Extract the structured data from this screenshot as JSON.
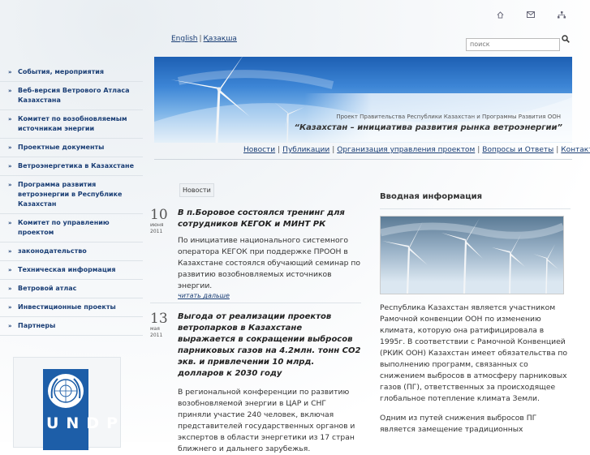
{
  "header": {
    "icons": [
      "home-icon",
      "mail-icon",
      "sitemap-icon"
    ],
    "lang_english": "English",
    "lang_kazakh": "Қазақша",
    "lang_sep": "|",
    "search_placeholder": "поиск"
  },
  "banner": {
    "subtitle": "Проект Правительства Республики Казахстан и Программы Развития ООН",
    "headline": "“Казахстан – инициатива развития рынка ветроэнергии”"
  },
  "topnav": {
    "items": [
      "Новости",
      "Публикации",
      "Организация управления проектом",
      "Вопросы и Ответы",
      "Контакты"
    ]
  },
  "sidebar": {
    "bullet": "»",
    "items": [
      "События, мероприятия",
      "Веб-версия Ветрового Атласа Казахстана",
      "Комитет по возобновляемым источникам энергии",
      "Проектные документы",
      "Ветроэнергетика в Казахстане",
      "Программа развития ветроэнергии в Республике Казахстан",
      "Комитет по управлению проектом",
      "законодательство",
      "Техническая информация",
      "Ветровой атлас",
      "Инвестиционные проекты",
      "Партнеры"
    ],
    "undp_letters": "UNDP"
  },
  "news": {
    "tab_label": "Новости",
    "items": [
      {
        "day": "10",
        "month": "июня",
        "year": "2011",
        "title": "В п.Боровое состоялся тренинг для сотрудников КЕГОК и МИНТ РК",
        "text": "По инициативе национального системного оператора КЕГОК при поддержке ПРООН в Казахстане состоялся обучающий семинар по развитию возобновляемых источников энергии.",
        "more": "читать дальше"
      },
      {
        "day": "13",
        "month": "мая",
        "year": "2011",
        "title": "Выгода от реализации проектов ветропарков в Казахстане выражается в сокращении выбросов парниковых газов на 4.2млн. тонн СО2 экв. и привлечении 10 млрд. долларов к 2030 году",
        "text": "В региональной конференции по развитию возобновляемой энергии в ЦАР и СНГ приняли участие 240 человек, включая представителей государственных органов и экспертов в области энергетики из 17 стран ближнего и дальнего зарубежья.",
        "more": ""
      }
    ]
  },
  "intro": {
    "title": "Вводная информация",
    "para1": "Республика Казахстан является участником Рамочной конвенции ООН по изменению климата, которую она ратифицировала в 1995г. В соответствии с Рамочной Конвенцией (РКИК ООН) Казахстан имеет обязательства по выполнению программ, связанных со снижением выбросов в атмосферу парниковых газов (ПГ), ответственных за происходящее глобальное потепление климата Земли.",
    "para2": "Одним из путей снижения выбросов ПГ является замещение традиционных"
  },
  "colors": {
    "link": "#1a3e75",
    "banner_sky": "#2f77c9",
    "undp_blue": "#1d5ea8"
  }
}
